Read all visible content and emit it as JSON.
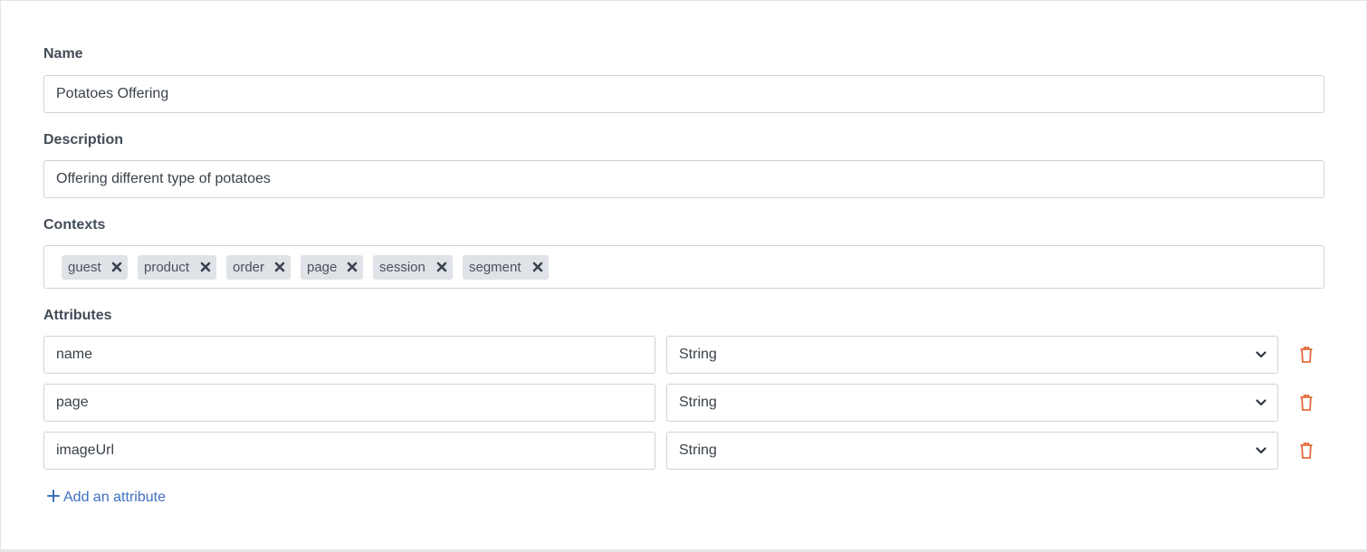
{
  "form": {
    "name_label": "Name",
    "name_value": "Potatoes Offering",
    "description_label": "Description",
    "description_value": "Offering different type of potatoes",
    "contexts_label": "Contexts",
    "contexts": [
      {
        "label": "guest"
      },
      {
        "label": "product"
      },
      {
        "label": "order"
      },
      {
        "label": "page"
      },
      {
        "label": "session"
      },
      {
        "label": "segment"
      }
    ],
    "attributes_label": "Attributes",
    "attributes": [
      {
        "name": "name",
        "type": "String"
      },
      {
        "name": "page",
        "type": "String"
      },
      {
        "name": "imageUrl",
        "type": "String"
      }
    ],
    "add_attribute_label": "Add an attribute"
  },
  "icons": {
    "chip_remove": "close-icon",
    "select_arrow": "chevron-down-icon",
    "delete": "trash-icon",
    "add": "plus-icon"
  },
  "colors": {
    "accent_link": "#3f6fc1",
    "delete_icon": "#e2693b",
    "chip_bg": "#dfe2e6"
  }
}
